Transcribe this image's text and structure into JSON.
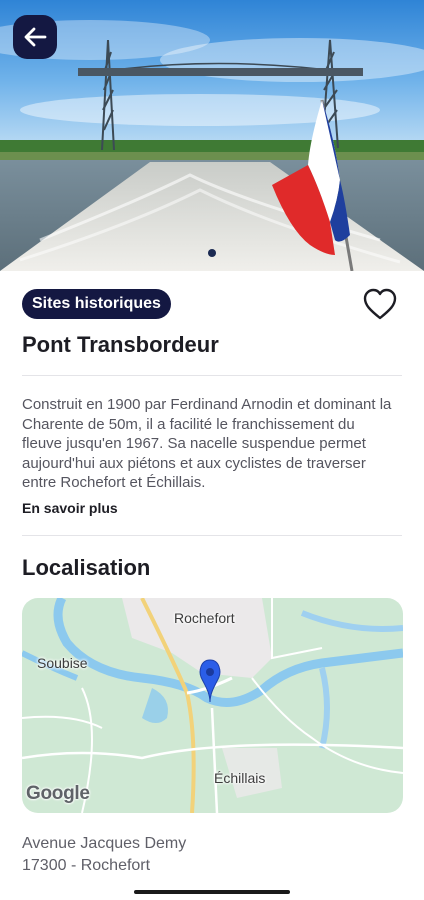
{
  "hero": {
    "image_alt": "Pont Transbordeur over the Charente with French flag",
    "back_icon": "arrow-left-icon",
    "carousel_active_index": 0,
    "carousel_count": 1
  },
  "place": {
    "category": "Sites historiques",
    "title": "Pont Transbordeur",
    "favorite_icon": "heart-outline-icon",
    "description": "Construit en 1900 par Ferdinand Arnodin et dominant la Charente de 50m, il a facilité le franchissement du fleuve jusqu'en 1967. Sa nacelle suspendue permet aujourd'hui aux piétons et aux cyclistes de traverser entre Rochefort et Échillais.",
    "more_label": "En savoir plus"
  },
  "location": {
    "section_title": "Localisation",
    "map": {
      "labels": [
        "Rochefort",
        "Soubise",
        "Échillais"
      ],
      "attribution": "Google",
      "pin_icon": "map-pin-icon"
    },
    "address_line1": "Avenue Jacques Demy",
    "address_line2": "17300 - Rochefort"
  },
  "colors": {
    "primary": "#141842",
    "map_land": "#cfe8d4",
    "map_water": "#8cc9ee",
    "pin": "#2b5ee8"
  }
}
